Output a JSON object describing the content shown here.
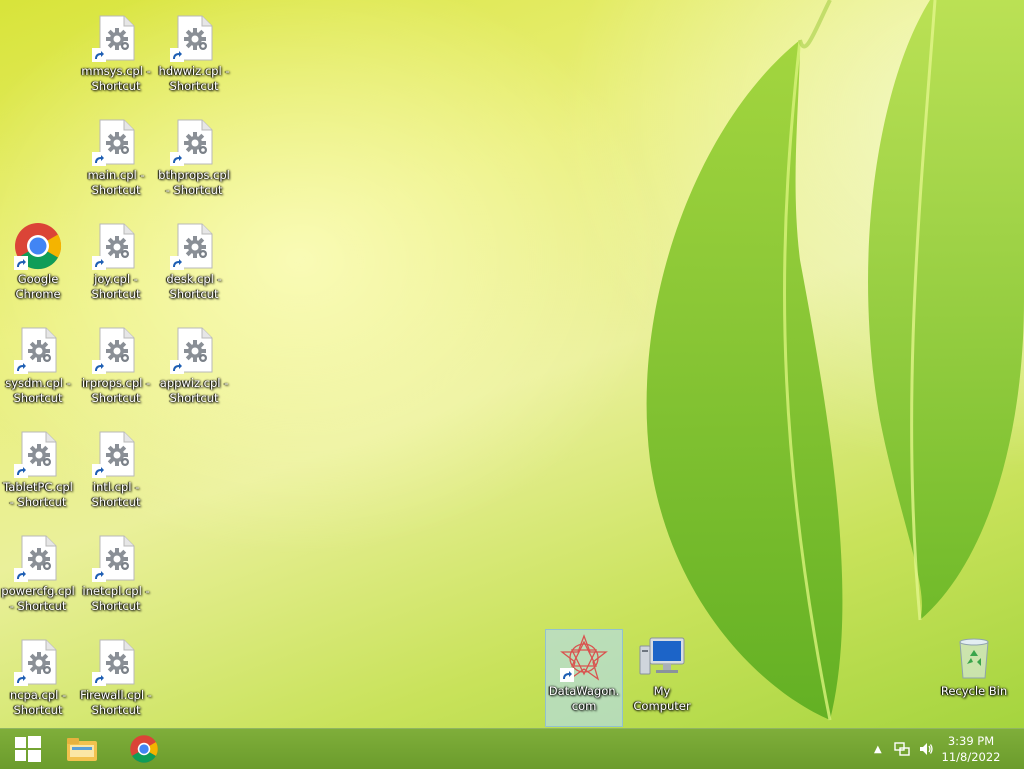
{
  "desktop": {
    "icons": [
      {
        "label": "mmsys.cpl - Shortcut",
        "type": "cpl"
      },
      {
        "label": "hdwwiz.cpl - Shortcut",
        "type": "cpl"
      },
      {
        "label": "main.cpl - Shortcut",
        "type": "cpl"
      },
      {
        "label": "bthprops.cpl - Shortcut",
        "type": "cpl"
      },
      {
        "label": "Google Chrome",
        "type": "chrome"
      },
      {
        "label": "joy.cpl - Shortcut",
        "type": "cpl"
      },
      {
        "label": "desk.cpl - Shortcut",
        "type": "cpl"
      },
      {
        "label": "sysdm.cpl - Shortcut",
        "type": "cpl"
      },
      {
        "label": "irprops.cpl - Shortcut",
        "type": "cpl"
      },
      {
        "label": "appwiz.cpl - Shortcut",
        "type": "cpl"
      },
      {
        "label": "TabletPC.cpl - Shortcut",
        "type": "cpl"
      },
      {
        "label": "intl.cpl - Shortcut",
        "type": "cpl"
      },
      {
        "label": "powercfg.cpl - Shortcut",
        "type": "cpl"
      },
      {
        "label": "inetcpl.cpl - Shortcut",
        "type": "cpl"
      },
      {
        "label": "ncpa.cpl - Shortcut",
        "type": "cpl"
      },
      {
        "label": "Firewall.cpl - Shortcut",
        "type": "cpl"
      },
      {
        "label": "DataWagon.com",
        "type": "datawagon",
        "selected": true
      },
      {
        "label": "My Computer",
        "type": "computer"
      },
      {
        "label": "Recycle Bin",
        "type": "recycle"
      }
    ]
  },
  "taskbar": {
    "items": [
      "start-windows-icon",
      "file-explorer-icon",
      "chrome-icon"
    ],
    "tray_icons": [
      "show-hidden-icons-chevron",
      "network-icon",
      "volume-icon"
    ],
    "clock": {
      "time": "3:39 PM",
      "date": "11/8/2022"
    }
  },
  "colors": {
    "taskbar": "#76a633",
    "selection": "#b4dceb"
  }
}
